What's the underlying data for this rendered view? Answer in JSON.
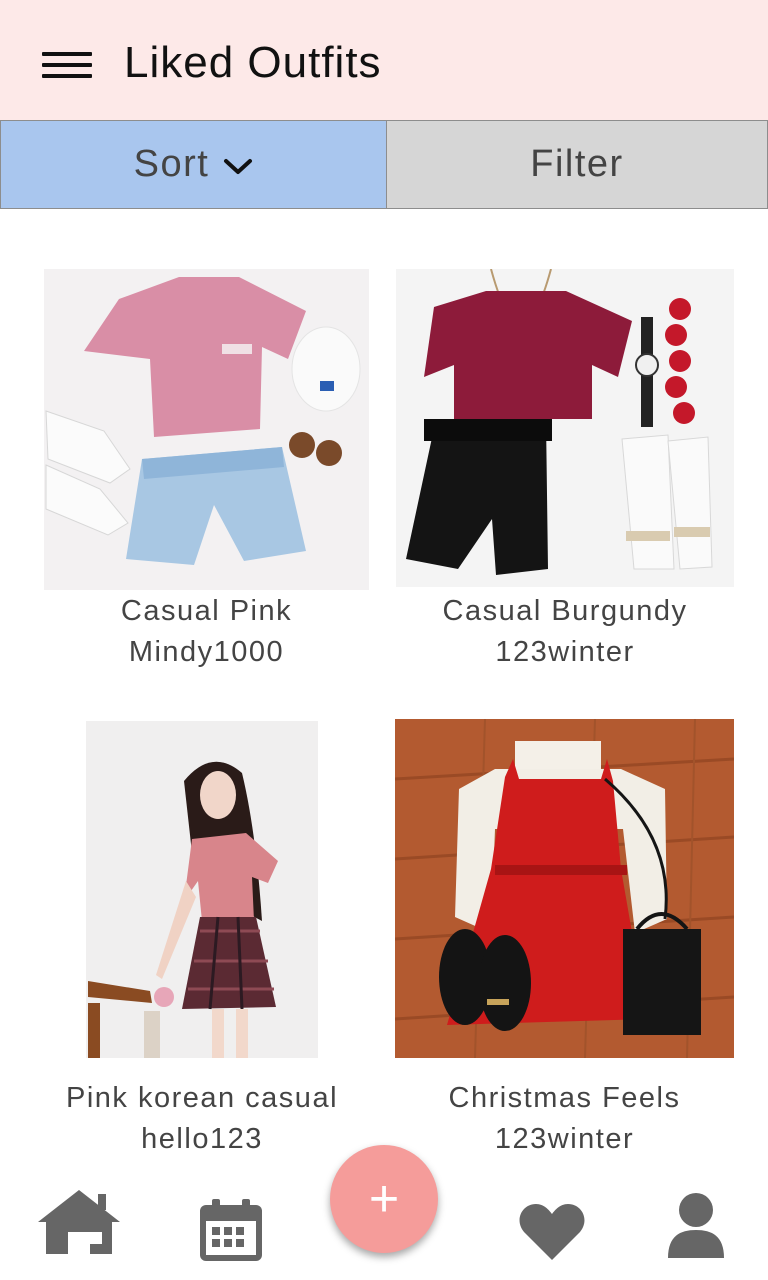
{
  "header": {
    "title": "Liked Outfits",
    "menu_icon": "hamburger-menu-icon",
    "background": "#fde9e8"
  },
  "toolbar": {
    "sort_label": "Sort",
    "filter_label": "Filter",
    "sort_color": "#a9c6ee",
    "filter_color": "#d6d6d6"
  },
  "outfits": [
    {
      "name": "Casual Pink",
      "user": "Mindy1000"
    },
    {
      "name": "Casual Burgundy",
      "user": "123winter"
    },
    {
      "name": "Pink korean casual",
      "user": "hello123"
    },
    {
      "name": "Christmas Feels",
      "user": "123winter"
    }
  ],
  "bottom_nav": {
    "items": [
      "home-icon",
      "calendar-icon",
      "add-icon",
      "heart-icon",
      "profile-icon"
    ],
    "fab_label": "+",
    "fab_color": "#f59c9a",
    "icon_color": "#666666"
  }
}
